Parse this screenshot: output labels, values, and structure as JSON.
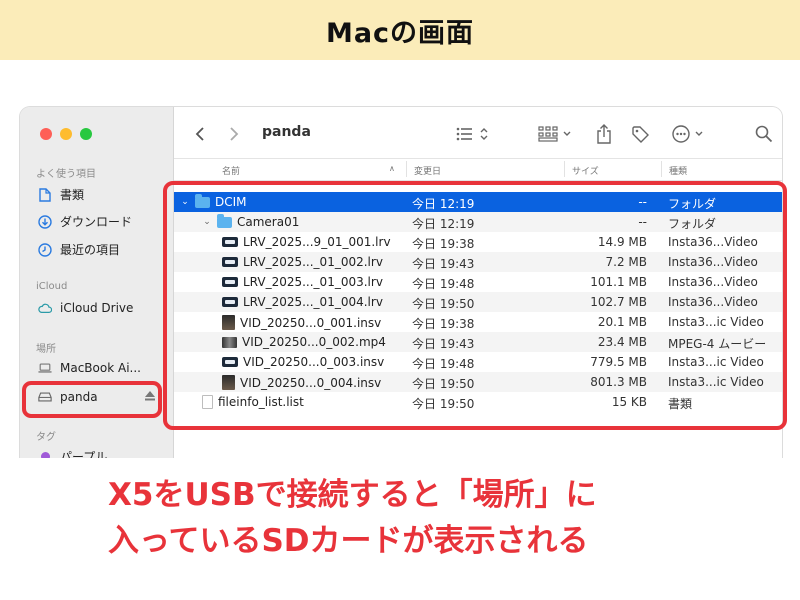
{
  "banner": {
    "title": "Macの画面"
  },
  "finder": {
    "title": "panda",
    "sidebar": {
      "favorites_header": "よく使う項目",
      "favorites": [
        {
          "label": "書類",
          "icon": "document-icon"
        },
        {
          "label": "ダウンロード",
          "icon": "download-icon"
        },
        {
          "label": "最近の項目",
          "icon": "clock-icon"
        }
      ],
      "icloud_header": "iCloud",
      "icloud_drive": "iCloud Drive",
      "locations_header": "場所",
      "macbook": "MacBook Ai...",
      "panda": "panda",
      "tags_header": "タグ",
      "tag_purple": "パープル"
    },
    "columns": {
      "name": "名前",
      "date": "変更日",
      "size": "サイズ",
      "kind": "種類"
    },
    "rows": [
      {
        "name": "DCIM",
        "date": "今日 12:19",
        "size": "--",
        "kind": "フォルダ",
        "type": "folder",
        "level": 0,
        "expanded": true,
        "selected": true
      },
      {
        "name": "Camera01",
        "date": "今日 12:19",
        "size": "--",
        "kind": "フォルダ",
        "type": "folder",
        "level": 1,
        "expanded": true,
        "selected": false
      },
      {
        "name": "LRV_2025...9_01_001.lrv",
        "date": "今日 19:38",
        "size": "14.9 MB",
        "kind": "Insta36...Video",
        "type": "lrv",
        "level": 2
      },
      {
        "name": "LRV_2025..._01_002.lrv",
        "date": "今日 19:43",
        "size": "7.2 MB",
        "kind": "Insta36...Video",
        "type": "lrv",
        "level": 2
      },
      {
        "name": "LRV_2025..._01_003.lrv",
        "date": "今日 19:48",
        "size": "101.1 MB",
        "kind": "Insta36...Video",
        "type": "lrv",
        "level": 2
      },
      {
        "name": "LRV_2025..._01_004.lrv",
        "date": "今日 19:50",
        "size": "102.7 MB",
        "kind": "Insta36...Video",
        "type": "lrv",
        "level": 2
      },
      {
        "name": "VID_20250...0_001.insv",
        "date": "今日 19:38",
        "size": "20.1 MB",
        "kind": "Insta3...ic Video",
        "type": "insv",
        "level": 2
      },
      {
        "name": "VID_20250...0_002.mp4",
        "date": "今日 19:43",
        "size": "23.4 MB",
        "kind": "MPEG-4 ムービー",
        "type": "mp4",
        "level": 2
      },
      {
        "name": "VID_20250...0_003.insv",
        "date": "今日 19:48",
        "size": "779.5 MB",
        "kind": "Insta3...ic Video",
        "type": "lrv",
        "level": 2
      },
      {
        "name": "VID_20250...0_004.insv",
        "date": "今日 19:50",
        "size": "801.3 MB",
        "kind": "Insta3...ic Video",
        "type": "insv",
        "level": 2
      },
      {
        "name": "fileinfo_list.list",
        "date": "今日 19:50",
        "size": "15 KB",
        "kind": "書類",
        "type": "doc",
        "level": 1
      }
    ]
  },
  "caption": {
    "line1": "X5をUSBで接続すると「場所」に",
    "line2": "入っているSDカードが表示される"
  },
  "colors": {
    "banner_bg": "#fbecb9",
    "highlight": "#e8333a",
    "selection": "#0a62e0"
  }
}
